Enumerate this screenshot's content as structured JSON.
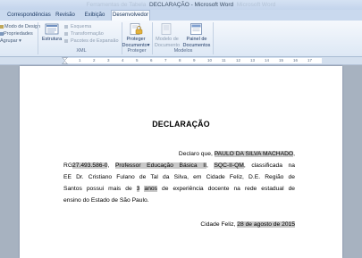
{
  "window": {
    "title": "DECLARAÇÃO - Microsoft Word",
    "blurred_prefix": "Ferramentas de Tabela",
    "blurred_suffix": "Microsoft Word"
  },
  "tabs": [
    "Correspondências",
    "Revisão",
    "Exibição",
    "Desenvolvedor"
  ],
  "active_tab": "Desenvolvedor",
  "ribbon": {
    "code": {
      "items": [
        "Modo de Design",
        "Propriedades",
        "Agrupar"
      ]
    },
    "xml": {
      "structure_label": "Estrutura",
      "items": [
        "Esquema",
        "Transformação",
        "Pacotes de Expansão"
      ],
      "group_label": "XML"
    },
    "protect": {
      "button_line1": "Proteger",
      "button_line2": "Documento",
      "group_label": "Proteger"
    },
    "templates": {
      "model_line1": "Modelo de",
      "model_line2": "Documento",
      "panel_line1": "Painel de",
      "panel_line2": "Documentos",
      "group_label": "Modelos"
    }
  },
  "ruler": {
    "numbers": [
      "1",
      "2",
      "3",
      "4",
      "5",
      "6",
      "7",
      "8",
      "9",
      "10",
      "11",
      "12",
      "13",
      "14",
      "15",
      "16",
      "17"
    ]
  },
  "document": {
    "title": "DECLARAÇÃO",
    "line1": {
      "pre": "Declaro que, ",
      "name": "PAULO DA SILVA MACHADO",
      "post": ","
    },
    "line2": {
      "rg_label": "RG",
      "rg": "27.493.586-0",
      "sep1": ",",
      "role": "Professor Educação Básica II",
      "sep2": ",",
      "reg": "SQC-II-QM",
      "post": ", classificada na"
    },
    "line3": "EE Dr. Cristiano Fulano de Tal da Silva, em Cidade Feliz, D.E. Região de",
    "line4": {
      "pre": "Santos possui mais de ",
      "years": "3",
      "sp": " ",
      "unit": "anos",
      "post": " de experiência docente na rede estadual de"
    },
    "line5": "ensino do Estado de São Paulo.",
    "date": {
      "city": "Cidade Feliz, ",
      "value": "28 de agosto de 2015"
    }
  }
}
